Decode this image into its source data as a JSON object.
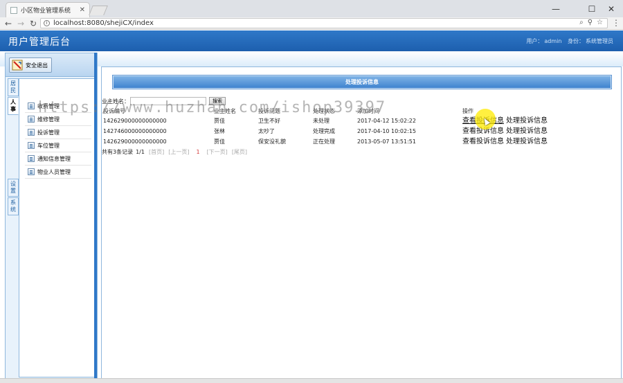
{
  "browser": {
    "tab_title": "小区物业管理系统",
    "url": "localhost:8080/shejiCX/index",
    "window_controls": {
      "minimize": "—",
      "restore": "☐",
      "close": "✕"
    }
  },
  "header": {
    "title": "用户管理后台",
    "user_label": "用户：",
    "user_name": "admin",
    "role_label": "身份：",
    "role_name": "系统管理员"
  },
  "sidebar": {
    "logout_label": "安全退出",
    "tabs": [
      {
        "label": "居民"
      },
      {
        "label": "人事"
      },
      {
        "label": "设置"
      },
      {
        "label": "系统"
      }
    ],
    "items": [
      {
        "label": "收费管理"
      },
      {
        "label": "维修管理"
      },
      {
        "label": "投诉管理"
      },
      {
        "label": "车位管理"
      },
      {
        "label": "通知信息管理"
      },
      {
        "label": "物业人员管理"
      }
    ]
  },
  "main": {
    "section_title": "处理投诉信息",
    "search": {
      "label": "业主姓名：",
      "value": "",
      "button": "搜索"
    },
    "columns": [
      "投诉编号",
      "业主姓名",
      "投诉问题",
      "处理状态",
      "添加时间",
      "操作"
    ],
    "rows": [
      {
        "id": "142629000000000000",
        "owner": "贾佳",
        "issue": "卫生不好",
        "status": "未处理",
        "time": "2017-04-12 15:02:22"
      },
      {
        "id": "142746000000000000",
        "owner": "张林",
        "issue": "太吵了",
        "status": "处理完成",
        "time": "2017-04-10 10:02:15"
      },
      {
        "id": "142629000000000000",
        "owner": "贾佳",
        "issue": "保安没礼貌",
        "status": "正在处理",
        "time": "2013-05-07 13:51:51"
      }
    ],
    "action_view": "查看投诉信息",
    "action_process": "处理投诉信息",
    "pager": {
      "total": "共有3条记录",
      "page_of": "1/1",
      "first": "[首页]",
      "prev": "[上一页]",
      "current": "1",
      "next": "[下一页]",
      "last": "[尾页]"
    }
  },
  "watermark": "https://www.huzhan.com/ishop39397",
  "colors": {
    "header_blue": "#1d5fae",
    "title_bar": "#3f83cf",
    "border": "#8fb7dd"
  }
}
